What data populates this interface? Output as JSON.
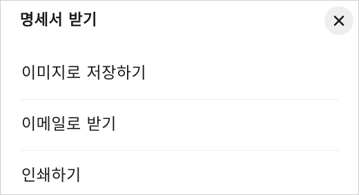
{
  "sheet": {
    "title": "명세서 받기",
    "close_icon": "close-icon"
  },
  "menu": {
    "items": [
      {
        "label": "이미지로 저장하기"
      },
      {
        "label": "이메일로 받기"
      },
      {
        "label": "인쇄하기"
      }
    ]
  },
  "colors": {
    "text": "#1a1a1a",
    "close_button_bg": "#eeeeee",
    "divider": "#ededed",
    "border": "#cfcfcf"
  }
}
